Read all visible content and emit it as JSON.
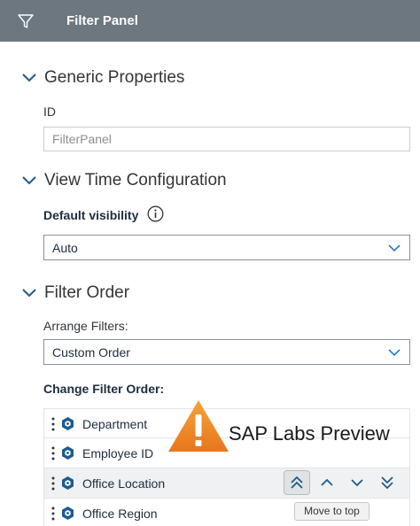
{
  "header": {
    "title": "Filter Panel",
    "icon": "funnel-icon"
  },
  "generic": {
    "heading": "Generic Properties",
    "id_label": "ID",
    "id_value": "FilterPanel"
  },
  "view_time": {
    "heading": "View Time Configuration",
    "default_visibility_label": "Default visibility",
    "default_visibility_value": "Auto"
  },
  "filter_order": {
    "heading": "Filter Order",
    "arrange_label": "Arrange Filters:",
    "arrange_value": "Custom Order",
    "change_label": "Change Filter Order:",
    "items": [
      {
        "name": "Department"
      },
      {
        "name": "Employee ID"
      },
      {
        "name": "Office Location"
      },
      {
        "name": "Office Region"
      }
    ],
    "tooltip": "Move to top"
  },
  "watermark": {
    "text": "SAP Labs Preview"
  },
  "colors": {
    "header_bg": "#6c7780",
    "accent": "#0a6ed1",
    "warning": "#f08a24"
  }
}
